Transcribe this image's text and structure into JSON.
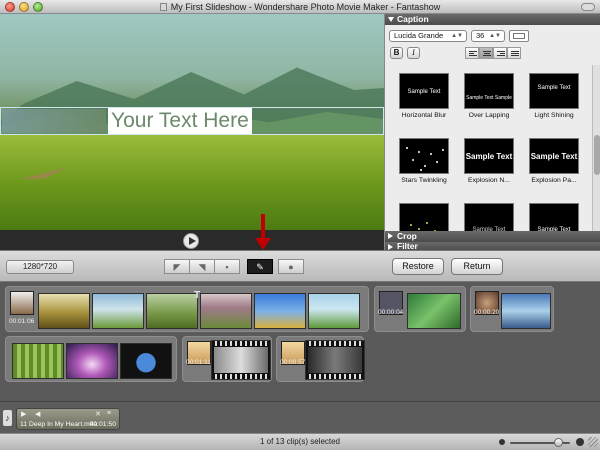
{
  "window": {
    "title": "My First Slideshow - Wondershare Photo Movie Maker - Fantashow"
  },
  "preview": {
    "caption_text": "Your Text Here"
  },
  "caption_panel": {
    "header": "Caption",
    "font_name": "Lucida Grande",
    "font_size": "36",
    "bold_label": "B",
    "italic_label": "I",
    "effects": [
      {
        "thumb_text": "Sample Text",
        "label": "Horizontal Blur"
      },
      {
        "thumb_text": "Sample Text  Sample Text",
        "label": "Over Lapping"
      },
      {
        "thumb_text": "Sample Text",
        "label": "Light Shining"
      },
      {
        "thumb_text": "",
        "label": "Stars Twinkling"
      },
      {
        "thumb_text": "Sample Text",
        "label": "Explosion N..."
      },
      {
        "thumb_text": "Sample Text",
        "label": "Explosion Pa..."
      },
      {
        "thumb_text": "",
        "label": ""
      },
      {
        "thumb_text": "Sample Text",
        "label": ""
      },
      {
        "thumb_text": "Sample Text",
        "label": ""
      }
    ],
    "crop_header": "Crop",
    "filter_header": "Filter"
  },
  "toolbar": {
    "resolution": "1280*720",
    "restore_label": "Restore",
    "return_label": "Return"
  },
  "storyboard": {
    "durations": [
      "00:01:06",
      "00:00:04",
      "00:00:20",
      "00:01:11",
      "00:00:57"
    ]
  },
  "audio": {
    "track_name": "11 Deep In My Heart.m4a",
    "duration": "00:01:50"
  },
  "statusbar": {
    "text": "1 of 13 clip(s) selected"
  }
}
